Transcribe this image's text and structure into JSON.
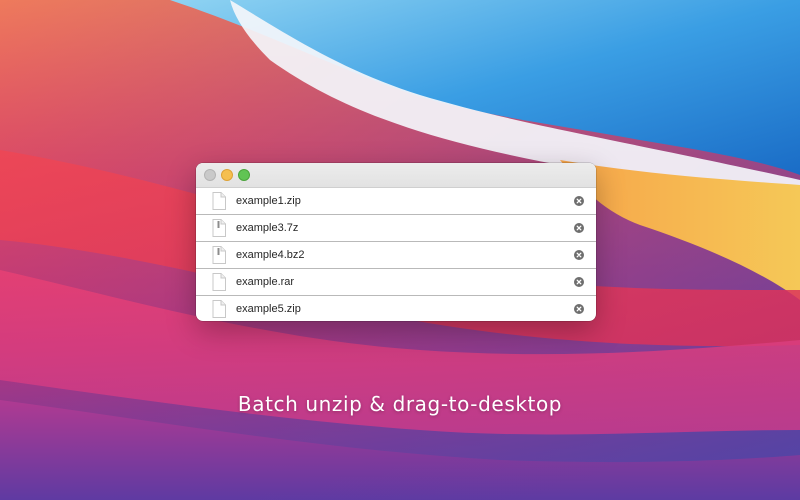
{
  "window": {
    "controls": [
      "close",
      "minimize",
      "maximize"
    ]
  },
  "files": [
    {
      "name": "example1.zip",
      "icon": "document-icon"
    },
    {
      "name": "example3.7z",
      "icon": "archive-icon"
    },
    {
      "name": "example4.bz2",
      "icon": "archive-icon"
    },
    {
      "name": "example.rar",
      "icon": "document-icon"
    },
    {
      "name": "example5.zip",
      "icon": "document-icon"
    }
  ],
  "caption": "Batch unzip & drag-to-desktop",
  "colors": {
    "close": "#c9c9c9",
    "minimize": "#f5bf4f",
    "maximize": "#61c454"
  }
}
